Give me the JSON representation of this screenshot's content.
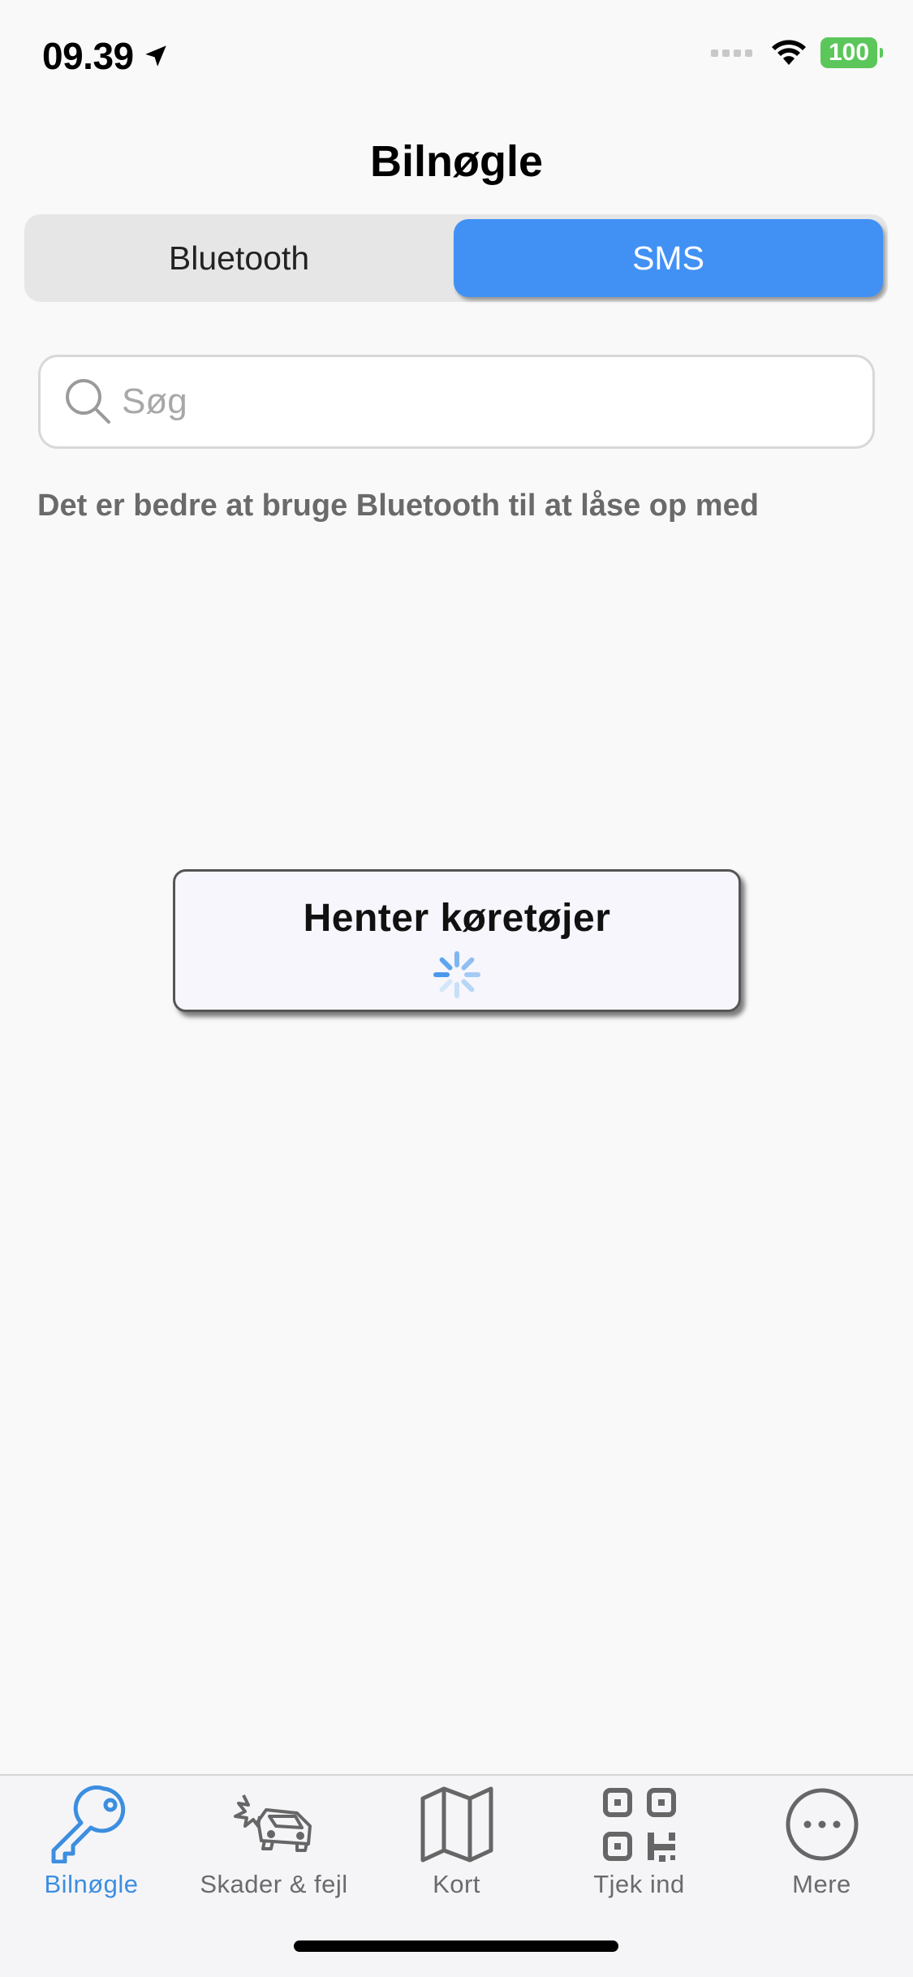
{
  "status_bar": {
    "time": "09.39",
    "battery": "100"
  },
  "header": {
    "title": "Bilnøgle"
  },
  "segments": [
    {
      "label": "Bluetooth",
      "selected": false
    },
    {
      "label": "SMS",
      "selected": true
    }
  ],
  "search": {
    "placeholder": "Søg",
    "value": ""
  },
  "hint_text": "Det er bedre at bruge Bluetooth til at låse op med",
  "loading": {
    "text": "Henter køretøjer"
  },
  "tabs": [
    {
      "label": "Bilnøgle",
      "icon": "key-icon",
      "active": true
    },
    {
      "label": "Skader & fejl",
      "icon": "car-damage-icon",
      "active": false
    },
    {
      "label": "Kort",
      "icon": "map-icon",
      "active": false
    },
    {
      "label": "Tjek ind",
      "icon": "qr-code-icon",
      "active": false
    },
    {
      "label": "Mere",
      "icon": "more-icon",
      "active": false
    }
  ],
  "colors": {
    "accent": "#4191f5",
    "tab_active": "#3c8ee0",
    "battery": "#5bc75a"
  }
}
